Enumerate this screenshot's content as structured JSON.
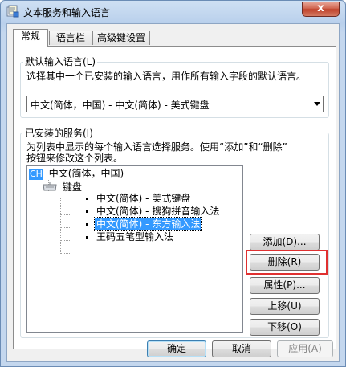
{
  "window": {
    "title": "文本服务和输入语言",
    "close_label": "x"
  },
  "tabs": [
    {
      "label": "常规",
      "active": true
    },
    {
      "label": "语言栏",
      "active": false
    },
    {
      "label": "高级键设置",
      "active": false
    }
  ],
  "default_lang": {
    "group_label": "默认输入语言(L)",
    "description": "选择其中一个已安装的输入语言，用作所有输入字段的默认语言。",
    "selected_value": "中文(简体，中国) - 中文(简体) - 美式键盘"
  },
  "services": {
    "group_label": "已安装的服务(I)",
    "description_line1": "为列表中显示的每个输入语言选择服务。使用“添加”和“删除”",
    "description_line2": "按钮来修改这个列表。",
    "tree": {
      "lang_badge": "CH",
      "lang_label": "中文(简体，中国)",
      "category_label": "键盘",
      "items": [
        {
          "label": "中文(简体) - 美式键盘",
          "selected": false
        },
        {
          "label": "中文(简体) - 搜狗拼音输入法",
          "selected": false
        },
        {
          "label": "中文(简体) - 东方输入法",
          "selected": true
        },
        {
          "label": "王码五笔型输入法",
          "selected": false
        }
      ]
    },
    "buttons": {
      "add": "添加(D)...",
      "remove": "删除(R)",
      "properties": "属性(P)...",
      "move_up": "上移(U)",
      "move_down": "下移(O)"
    }
  },
  "footer": {
    "ok": "确定",
    "cancel": "取消",
    "apply": "应用(A)"
  },
  "colors": {
    "selection": "#3399ff",
    "highlight_box": "#e03030"
  }
}
